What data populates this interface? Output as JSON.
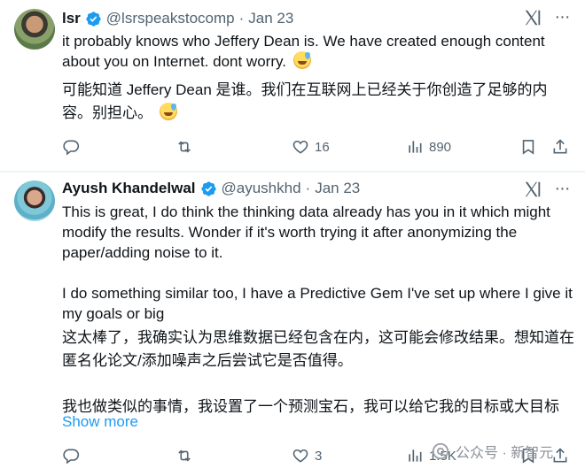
{
  "tweets": [
    {
      "name": "lsr",
      "handle": "@lsrspeakstocomp",
      "separator": "·",
      "date": "Jan 23",
      "text_en": "it probably knows who Jeffery Dean is. We have created enough content about you on Internet. dont worry.",
      "text_zh": "可能知道 Jeffery Dean 是谁。我们在互联网上已经关于你创造了足够的内容。别担心。",
      "emoji_icon": "sweat-smile-emoji-icon",
      "actions": {
        "reply_count": "",
        "retweet_count": "",
        "like_count": "16",
        "views_count": "890"
      }
    },
    {
      "name": "Ayush Khandelwal",
      "handle": "@ayushkhd",
      "separator": "·",
      "date": "Jan 23",
      "text_en": "This is great, I do think the thinking data already has you in it which might modify the results. Wonder if it's worth trying it after anonymizing the paper/adding noise to it.\n\nI do something similar too, I have a Predictive Gem I've set up where I give it my goals or big",
      "text_zh": "这太棒了，我确实认为思维数据已经包含在内，这可能会修改结果。想知道在匿名化论文/添加噪声之后尝试它是否值得。\n\n我也做类似的事情，我设置了一个预测宝石，我可以给它我的目标或大目标",
      "show_more": "Show more",
      "actions": {
        "reply_count": "",
        "retweet_count": "",
        "like_count": "3",
        "views_count": "1.5K"
      }
    }
  ],
  "watermark": {
    "text": "公众号 · 新智元",
    "icon": "wechat-official-account-icon"
  },
  "colors": {
    "text": "#0f1419",
    "secondary": "#536471",
    "accent": "#1d9bf0",
    "divider": "#eff3f4"
  }
}
